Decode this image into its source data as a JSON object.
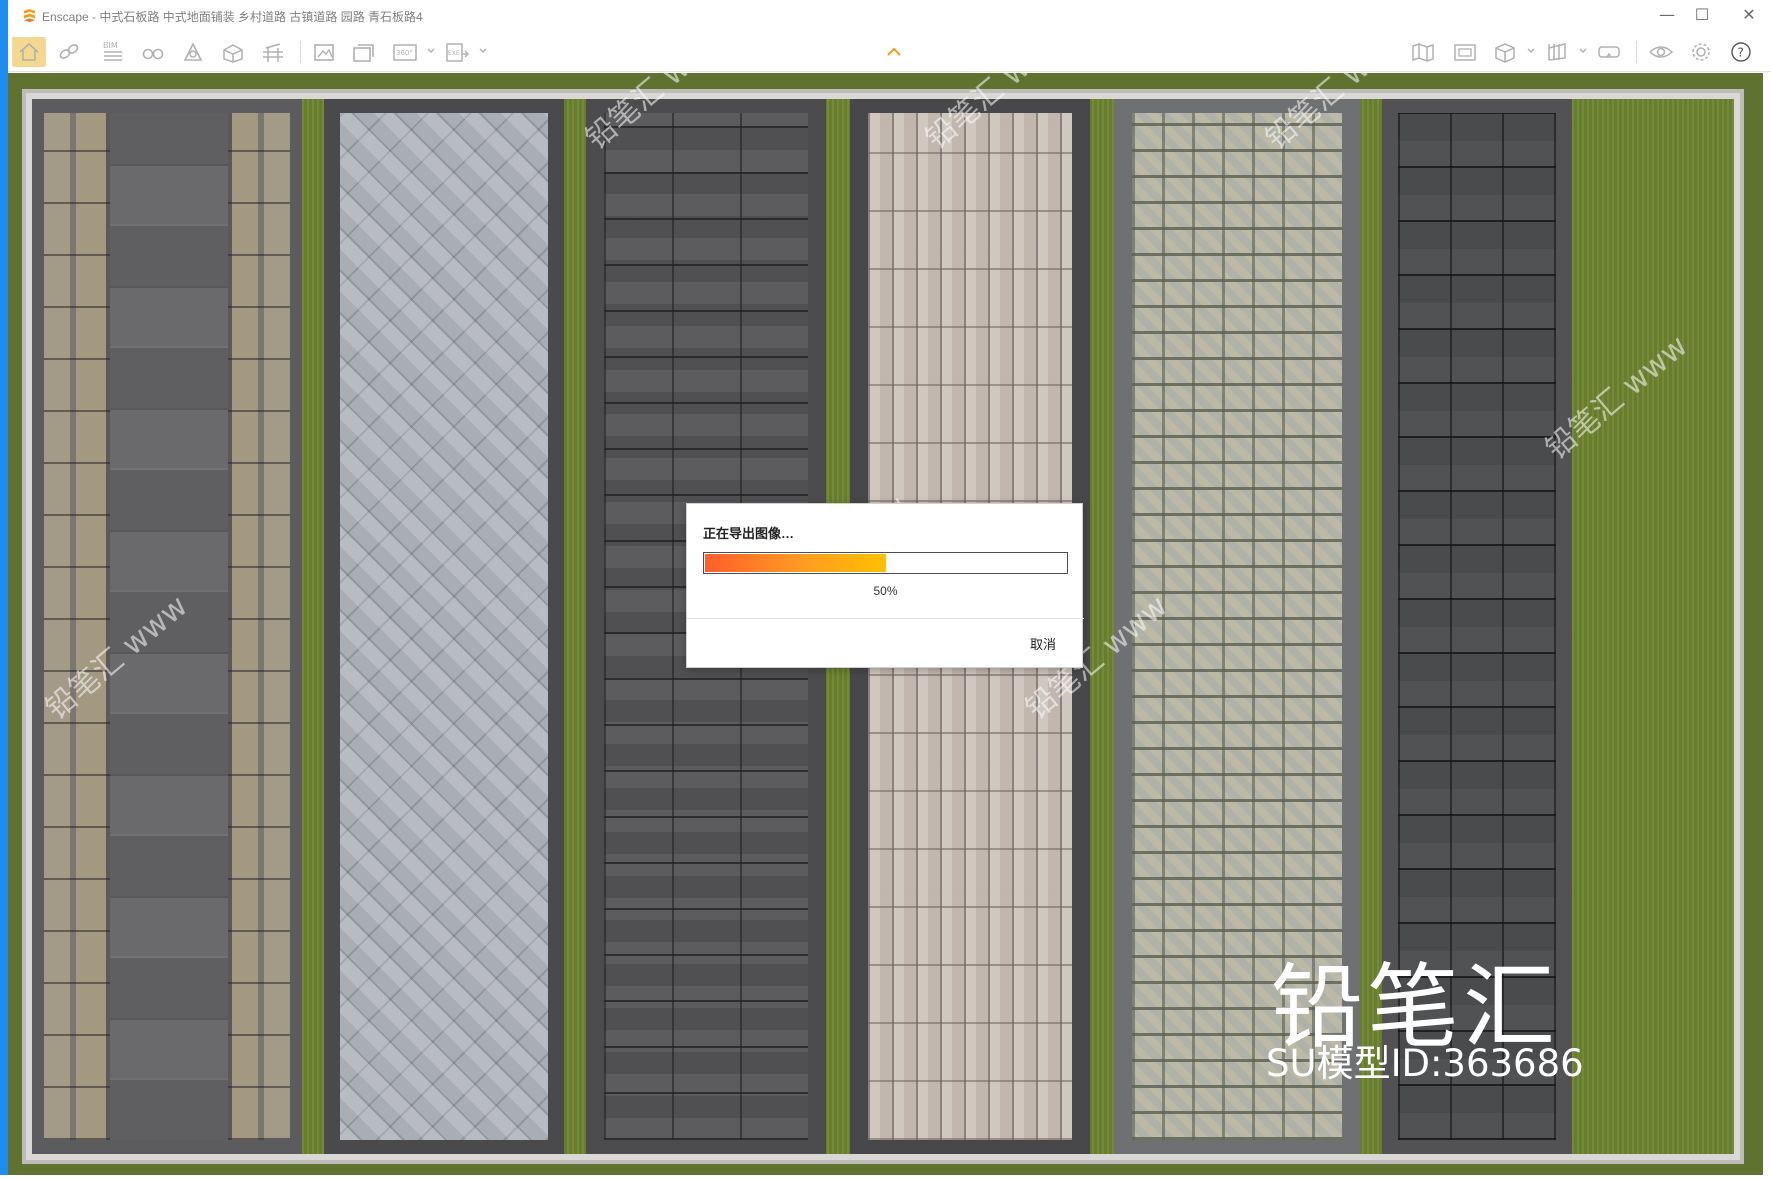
{
  "window": {
    "title": "Enscape - 中式石板路 中式地面铺装 乡村道路 古镇道路 园路 青石板路4",
    "minimize_glyph": "—",
    "maximize_glyph": "☐",
    "close_glyph": "✕",
    "accent_color": "#1f8cf0"
  },
  "toolbar": {
    "buttons": [
      {
        "name": "home-icon",
        "label": "Home"
      },
      {
        "name": "link-icon",
        "label": "Live Update"
      },
      {
        "name": "bim-icon",
        "label": "BIM"
      },
      {
        "name": "binoculars-icon",
        "label": "Views"
      },
      {
        "name": "atmosphere-icon",
        "label": "Atmosphere"
      },
      {
        "name": "objects-icon",
        "label": "Assets"
      },
      {
        "name": "materials-icon",
        "label": "Materials"
      },
      {
        "name": "screenshot-icon",
        "label": "Render Image"
      },
      {
        "name": "batch-render-icon",
        "label": "Batch Render"
      },
      {
        "name": "panorama-icon",
        "label": "360 Panorama"
      },
      {
        "name": "export-icon",
        "label": "Export"
      },
      {
        "name": "map-icon",
        "label": "Map"
      },
      {
        "name": "video-editor-icon",
        "label": "Video Editor"
      },
      {
        "name": "view-cube-icon",
        "label": "View Mode"
      },
      {
        "name": "sections-icon",
        "label": "Sections"
      },
      {
        "name": "vr-headset-icon",
        "label": "VR"
      },
      {
        "name": "eye-icon",
        "label": "Visual Settings"
      },
      {
        "name": "settings-icon",
        "label": "Settings"
      },
      {
        "name": "help-icon",
        "label": "Help"
      }
    ],
    "bim_text": "BIM",
    "pano_text": "360°",
    "export_text": "EXE",
    "help_text": "?"
  },
  "dialog": {
    "title": "正在导出图像…",
    "progress": 0.5,
    "progress_text": "50%",
    "cancel_label": "取消"
  },
  "watermark": {
    "brand": "铅笔汇",
    "model_id": "SU模型ID:363686",
    "diagonal": "铅笔汇 www"
  }
}
